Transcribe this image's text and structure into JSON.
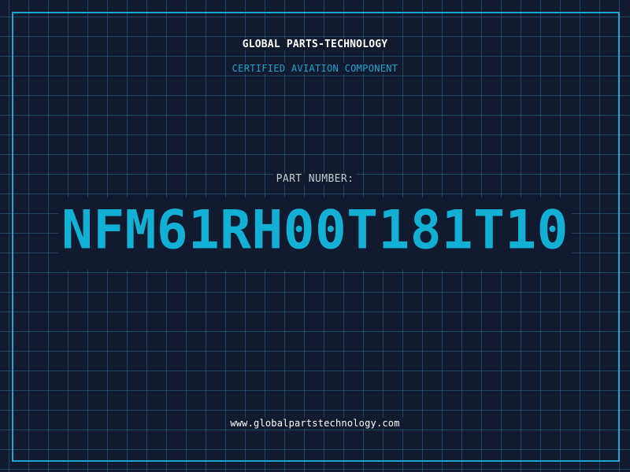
{
  "header": {
    "company": "GLOBAL PARTS-TECHNOLOGY",
    "tagline": "CERTIFIED AVIATION COMPONENT"
  },
  "part": {
    "label": "PART NUMBER:",
    "number": "NFM61RH00T181T10"
  },
  "footer": {
    "website": "www.globalpartstechnology.com"
  },
  "colors": {
    "background": "#111a2e",
    "accent": "#13b0d6",
    "grid": "#286e8c",
    "text": "#ffffff",
    "label": "#c8ccd4"
  }
}
